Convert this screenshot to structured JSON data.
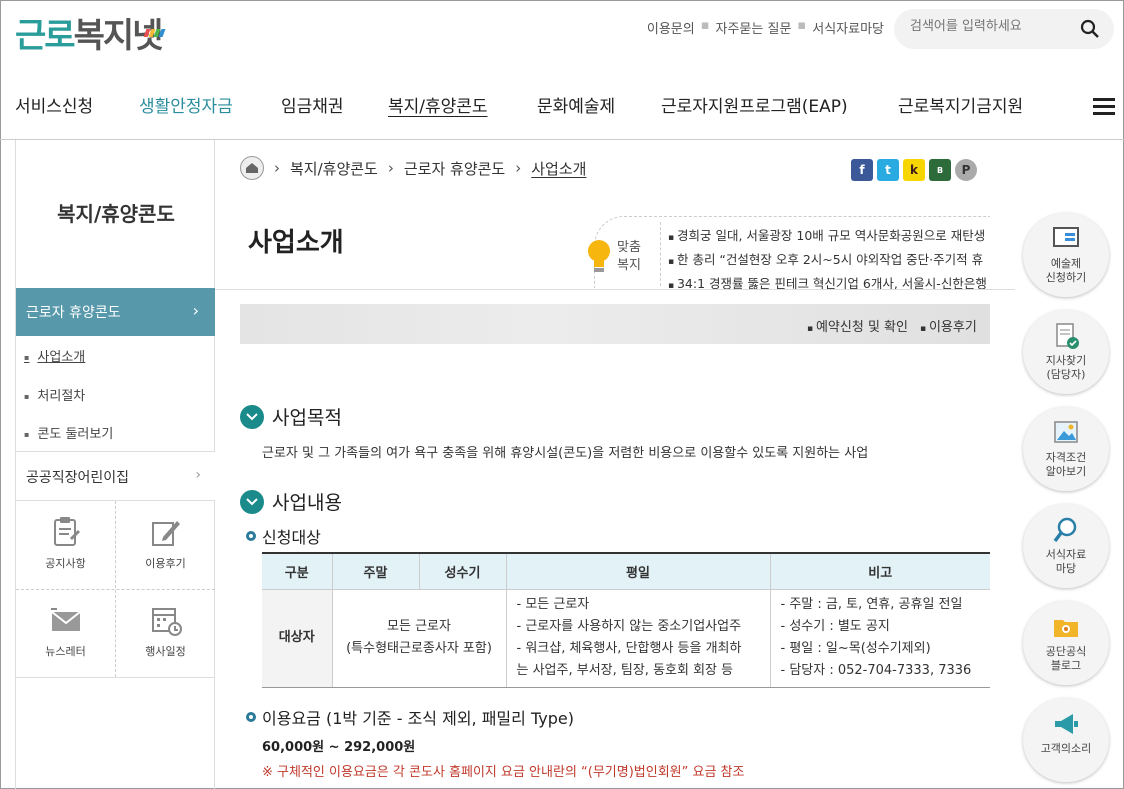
{
  "logo": {
    "part1": "근로",
    "part2": "복지",
    "part3": "넷",
    "bar_colors": [
      "#e94f4f",
      "#f5b935",
      "#4cb848",
      "#2f8fd0"
    ]
  },
  "util_links": [
    "이용문의",
    "자주묻는 질문",
    "서식자료마당"
  ],
  "search": {
    "placeholder": "검색어를 입력하세요"
  },
  "gnb": [
    "서비스신청",
    "생활안정자금",
    "임금채권",
    "복지/휴양콘도",
    "문화예술제",
    "근로자지원프로그램(EAP)",
    "근로복지기금지원"
  ],
  "sidebar": {
    "title": "복지/휴양콘도",
    "active": "근로자 휴양콘도",
    "subs": [
      "사업소개",
      "처리절차",
      "콘도 둘러보기"
    ],
    "item2": "공공직장어린이집",
    "quick": [
      "공지사항",
      "이용후기",
      "뉴스레터",
      "행사일정"
    ]
  },
  "breadcrumb": [
    "복지/휴양콘도",
    "근로자 휴양콘도",
    "사업소개"
  ],
  "sns": [
    "f",
    "t",
    "k",
    "B",
    "P"
  ],
  "page_title": "사업소개",
  "news": {
    "label": [
      "맞춤",
      "복지"
    ],
    "items": [
      "경희궁 일대, 서울광장 10배 규모 역사문화공원으로 재탄생",
      "한 총리 “건설현장 오후 2시~5시 야외작업 중단·주기적 휴",
      "34:1 경쟁률 뚫은 핀테크 혁신기업 6개사, 서울시-신한은행"
    ]
  },
  "banner_links": [
    "예약신청 및 확인",
    "이용후기"
  ],
  "section1": {
    "title": "사업목적",
    "desc": "근로자 및 그 가족들의 여가 욕구 충족을 위해 휴양시설(콘도)을 저렴한 비용으로 이용할수 있도록 지원하는 사업"
  },
  "section2": {
    "title": "사업내용"
  },
  "sub1": "신청대상",
  "table": {
    "headers": [
      "구분",
      "주말",
      "성수기",
      "평일",
      "비고"
    ],
    "row_label": "대상자",
    "weekend_cell": [
      "모든 근로자",
      "(특수형태근로종사자 포함)"
    ],
    "weekday": [
      "- 모든 근로자",
      "- 근로자를 사용하지 않는 중소기업사업주",
      "- 워크샵, 체육행사, 단합행사 등을 개최하",
      "는 사업주, 부서장, 팀장, 동호회 회장 등"
    ],
    "remarks": [
      "- 주말 : 금, 토, 연휴, 공휴일 전일",
      "- 성수기 : 별도 공지",
      "- 평일 : 일~목(성수기제외)",
      "- 담당자 : 052-704-7333, 7336"
    ]
  },
  "sub2": "이용요금 (1박 기준 - 조식 제외, 패밀리 Type)",
  "price": "60,000원 ~ 292,000원",
  "note": "※ 구체적인 이용요금은 각 콘도사 홈페이지 요금 안내란의 “(무기명)법인회원” 요금 참조",
  "right_quick": [
    [
      "예술제",
      "신청하기"
    ],
    [
      "지사찾기",
      "(담당자)"
    ],
    [
      "자격조건",
      "알아보기"
    ],
    [
      "서식자료",
      "마당"
    ],
    [
      "공단공식",
      "블로그"
    ],
    [
      "고객의소리"
    ]
  ],
  "colors": {
    "accent": "#5798aa",
    "teal": "#1b8a8a",
    "note": "#c0392b"
  }
}
